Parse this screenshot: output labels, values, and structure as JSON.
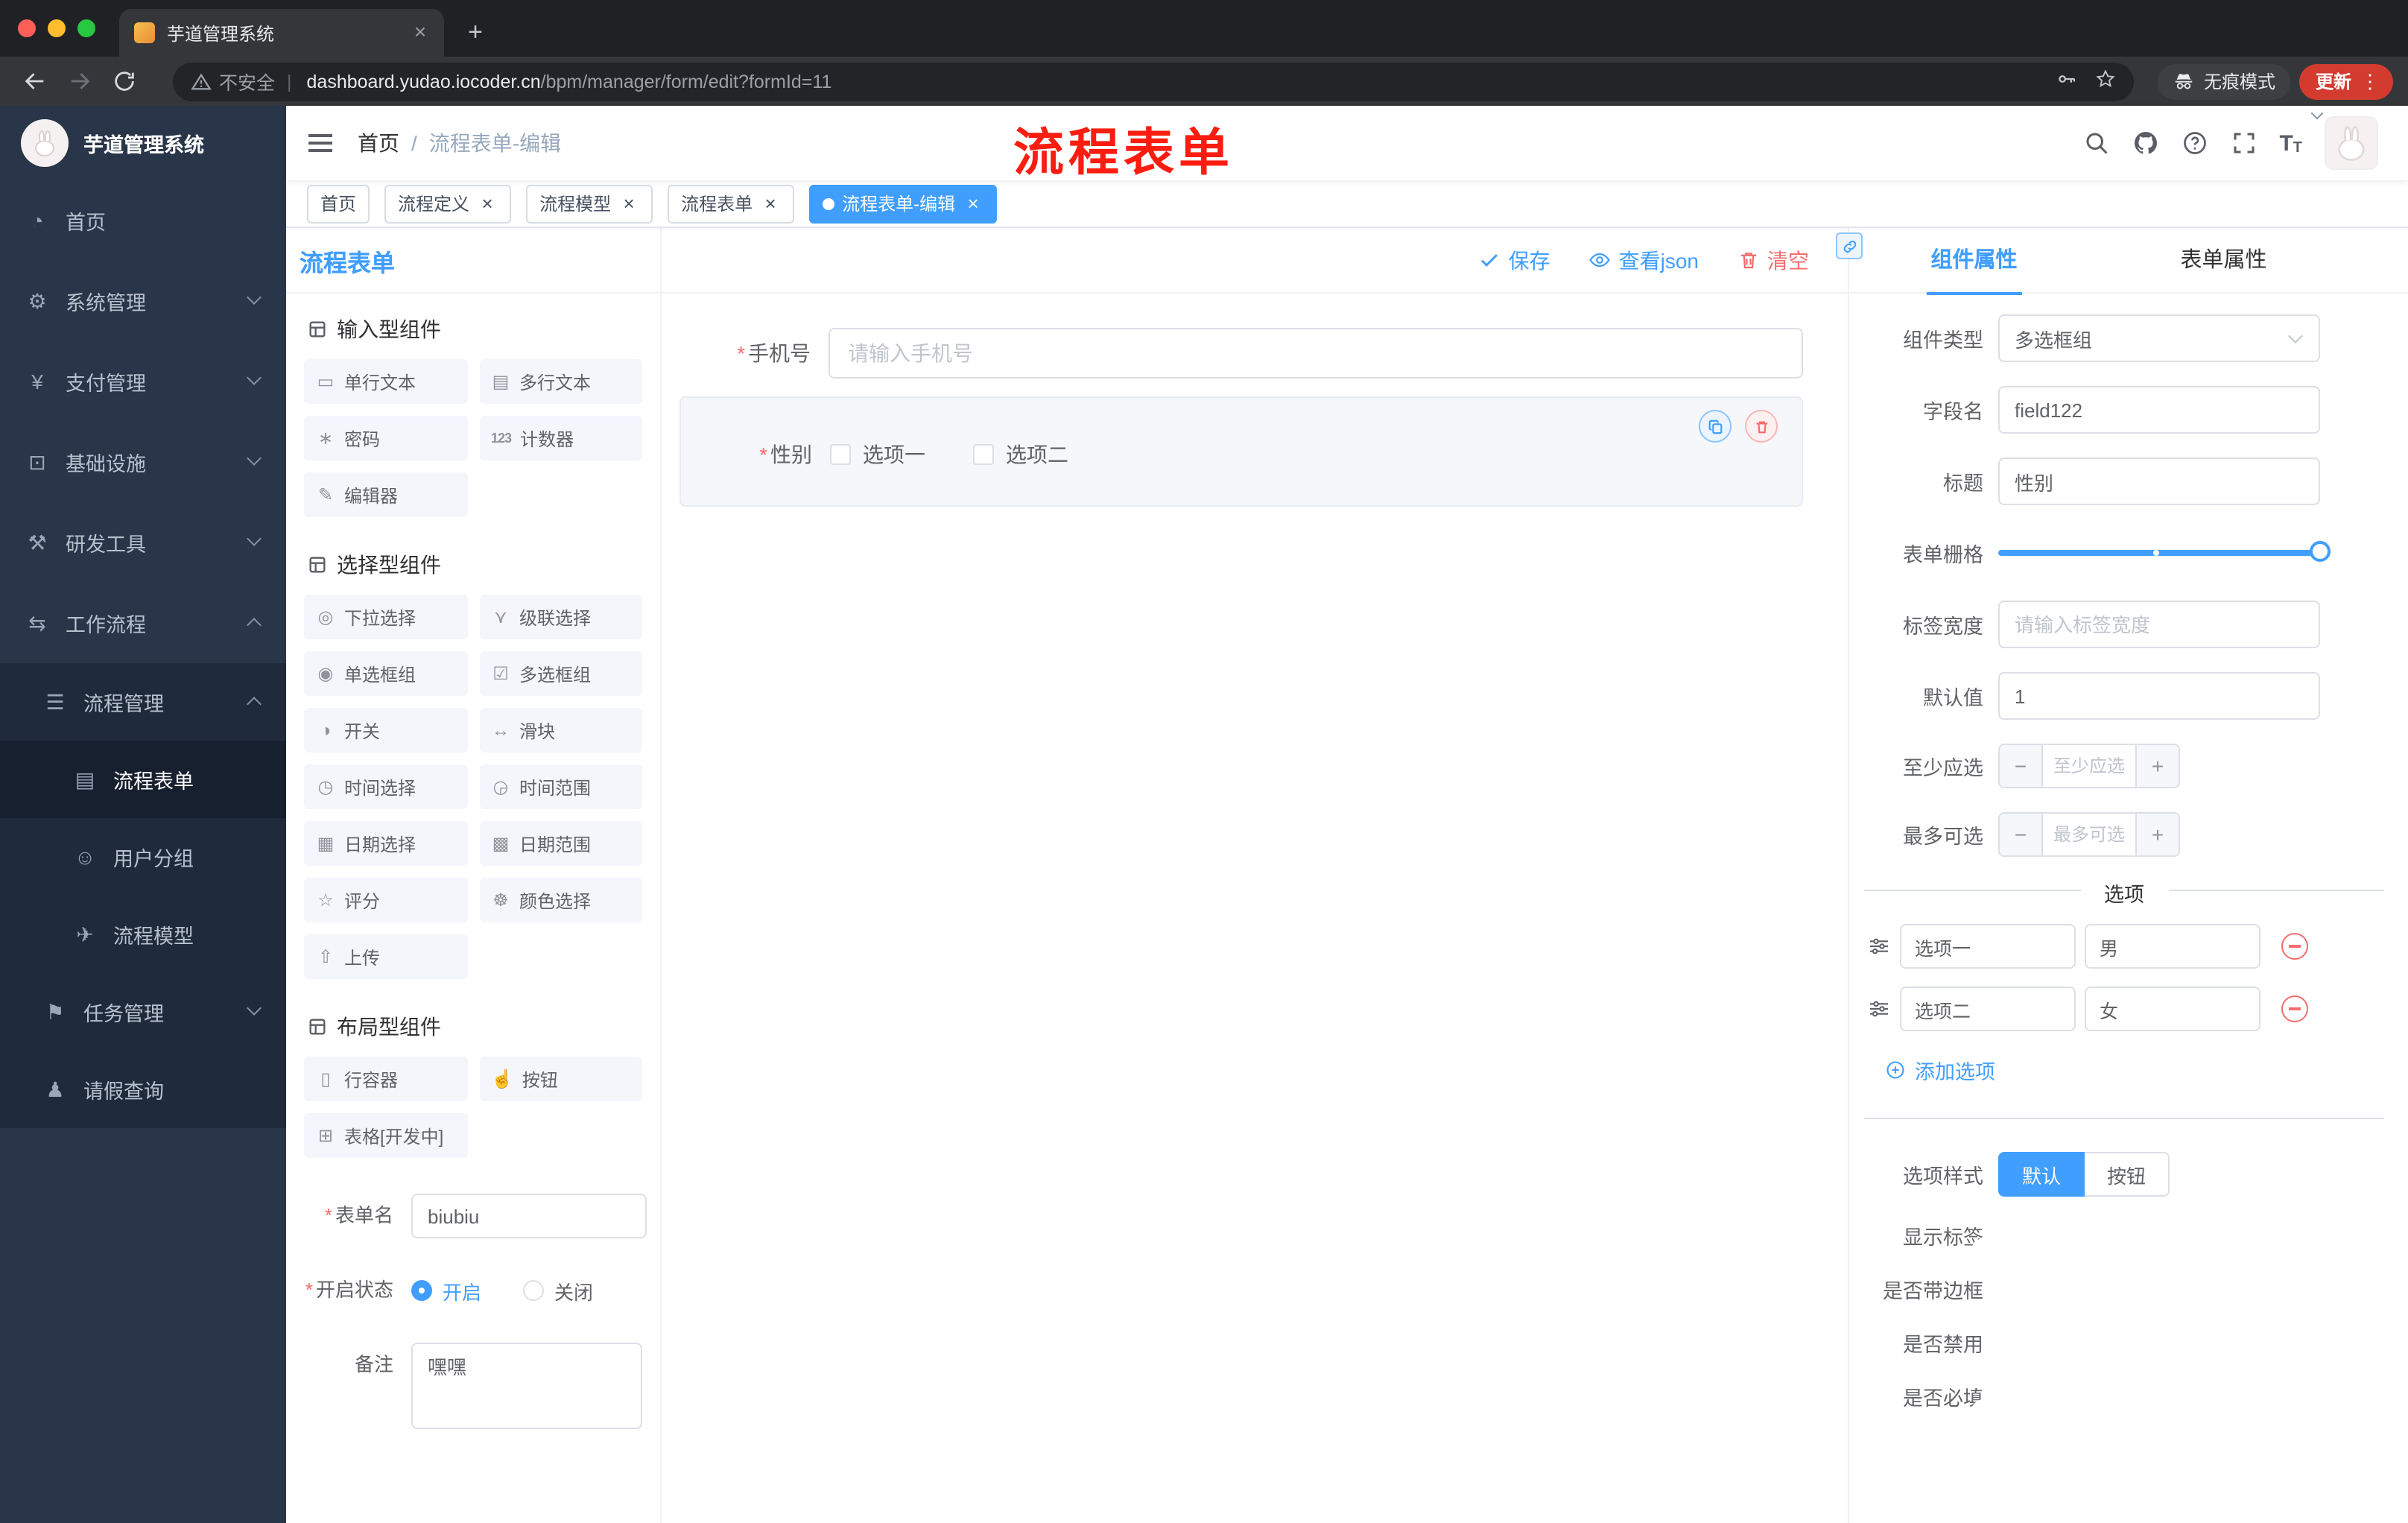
{
  "ui": {
    "close": "×",
    "required": "*",
    "plus": "+",
    "minus": "−",
    "kebab": "⋮",
    "slash": "/",
    "pipe": "|",
    "t": "T"
  },
  "browser": {
    "tab_title": "芋道管理系统",
    "security": "不安全",
    "url_host": "dashboard.yudao.iocoder.cn",
    "url_path": "/bpm/manager/form/edit?formId=11",
    "incognito": "无痕模式",
    "update": "更新"
  },
  "sidebar": {
    "title": "芋道管理系统",
    "menu": [
      {
        "label": "首页",
        "icon": "◔"
      },
      {
        "label": "系统管理",
        "icon": "⚙"
      },
      {
        "label": "支付管理",
        "icon": "¥"
      },
      {
        "label": "基础设施",
        "icon": "⊡"
      },
      {
        "label": "研发工具",
        "icon": "⚒"
      },
      {
        "label": "工作流程",
        "icon": "⇆"
      },
      {
        "label": "流程管理",
        "icon": "☰"
      },
      {
        "label": "流程表单",
        "icon": "▤"
      },
      {
        "label": "用户分组",
        "icon": "☺"
      },
      {
        "label": "流程模型",
        "icon": "✈"
      },
      {
        "label": "任务管理",
        "icon": "⚑"
      },
      {
        "label": "请假查询",
        "icon": "♟"
      }
    ]
  },
  "header": {
    "breadcrumb_home": "首页",
    "breadcrumb_current": "流程表单-编辑",
    "annotation": "流程表单"
  },
  "tags": [
    {
      "label": "首页"
    },
    {
      "label": "流程定义"
    },
    {
      "label": "流程模型"
    },
    {
      "label": "流程表单"
    },
    {
      "label": "流程表单-编辑"
    }
  ],
  "designer": {
    "title": "流程表单",
    "save": "保存",
    "view_json": "查看json",
    "clear": "清空",
    "group_input": "输入型组件",
    "group_select": "选择型组件",
    "group_layout": "布局型组件",
    "comp_input": [
      {
        "label": "单行文本",
        "icon": "▭"
      },
      {
        "label": "多行文本",
        "icon": "▤"
      },
      {
        "label": "密码",
        "icon": "∗"
      },
      {
        "label": "计数器",
        "icon": "123"
      },
      {
        "label": "编辑器",
        "icon": "✎"
      }
    ],
    "comp_select": [
      {
        "label": "下拉选择",
        "icon": "◎"
      },
      {
        "label": "级联选择",
        "icon": "⋎"
      },
      {
        "label": "单选框组",
        "icon": "◉"
      },
      {
        "label": "多选框组",
        "icon": "☑"
      },
      {
        "label": "开关",
        "icon": "◑"
      },
      {
        "label": "滑块",
        "icon": "↔"
      },
      {
        "label": "时间选择",
        "icon": "◷"
      },
      {
        "label": "时间范围",
        "icon": "◶"
      },
      {
        "label": "日期选择",
        "icon": "▦"
      },
      {
        "label": "日期范围",
        "icon": "▩"
      },
      {
        "label": "评分",
        "icon": "☆"
      },
      {
        "label": "颜色选择",
        "icon": "☸"
      },
      {
        "label": "上传",
        "icon": "⇧"
      }
    ],
    "comp_layout": [
      {
        "label": "行容器",
        "icon": "▯"
      },
      {
        "label": "按钮",
        "icon": "☝"
      },
      {
        "label": "表格[开发中]",
        "icon": "⊞"
      }
    ],
    "meta": {
      "name_label": "表单名",
      "name_value": "biubiu",
      "status_label": "开启状态",
      "status_on": "开启",
      "status_off": "关闭",
      "remark_label": "备注",
      "remark_value": "嘿嘿"
    },
    "canvas": {
      "phone_label": "手机号",
      "phone_placeholder": "请输入手机号",
      "gender_label": "性别",
      "gender_options": [
        "选项一",
        "选项二"
      ]
    }
  },
  "props": {
    "tab_component": "组件属性",
    "tab_form": "表单属性",
    "type_label": "组件类型",
    "type_value": "多选框组",
    "field_label": "字段名",
    "field_value": "field122",
    "title_label": "标题",
    "title_value": "性别",
    "grid_label": "表单栅格",
    "label_width_label": "标签宽度",
    "label_width_placeholder": "请输入标签宽度",
    "default_label": "默认值",
    "default_value": "1",
    "min_label": "至少应选",
    "min_placeholder": "至少应选",
    "max_label": "最多可选",
    "max_placeholder": "最多可选",
    "options_divider": "选项",
    "options": [
      {
        "name": "选项一",
        "value": "男"
      },
      {
        "name": "选项二",
        "value": "女"
      }
    ],
    "add_option": "添加选项",
    "style_label": "选项样式",
    "style_default": "默认",
    "style_button": "按钮",
    "switch_show_label": "显示标签",
    "switch_border": "是否带边框",
    "switch_disabled": "是否禁用",
    "switch_required": "是否必填",
    "switch_states": {
      "show_label": true,
      "border": false,
      "disabled": false,
      "required": true
    }
  }
}
